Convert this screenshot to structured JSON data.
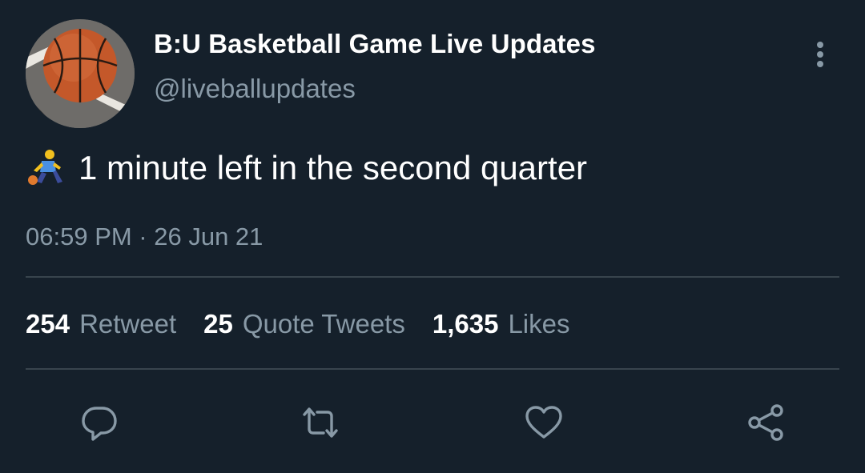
{
  "tweet": {
    "display_name": "B:U Basketball Game Live Updates",
    "handle": "@liveballupdates",
    "text": "1 minute left in the second quarter",
    "text_emoji": "person-bouncing-ball-emoji",
    "timestamp": "06:59 PM · 26 Jun 21"
  },
  "stats": [
    {
      "count": "254",
      "label": "Retweet"
    },
    {
      "count": "25",
      "label": "Quote Tweets"
    },
    {
      "count": "1,635",
      "label": "Likes"
    }
  ],
  "icons": {
    "more": "more-vertical-icon",
    "reply": "reply-icon",
    "retweet": "retweet-icon",
    "like": "heart-icon",
    "share": "share-icon"
  },
  "colors": {
    "background": "#15202b",
    "secondary_text": "#8899a6",
    "divider": "#38444d",
    "primary_text": "#ffffff"
  }
}
